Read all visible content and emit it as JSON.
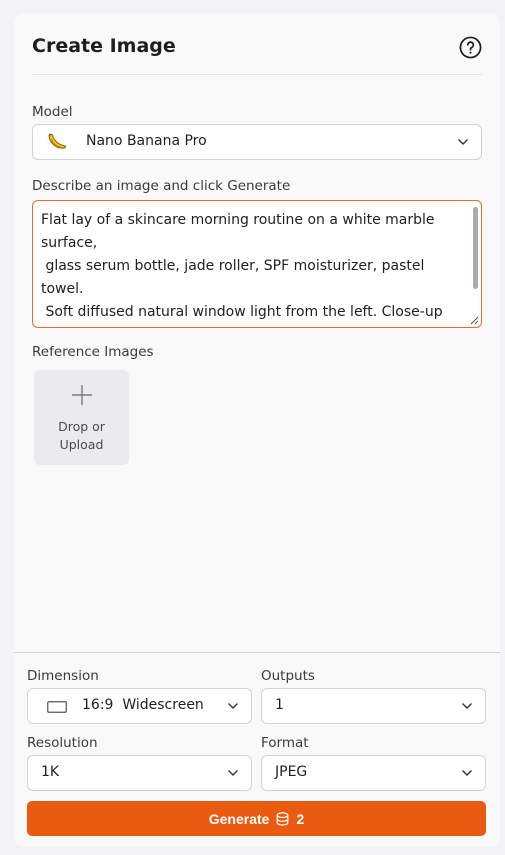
{
  "header": {
    "title": "Create Image",
    "help_icon": "question-circle-icon"
  },
  "model": {
    "label": "Model",
    "icon": "banana-icon",
    "selected": "Nano Banana Pro"
  },
  "prompt": {
    "label": "Describe an image and click Generate",
    "value": "Flat lay of a skincare morning routine on a white marble surface,\n glass serum bottle, jade roller, SPF moisturizer, pastel towel.\n Soft diffused natural window light from the left. Close-up overhead shot."
  },
  "reference": {
    "label": "Reference Images",
    "upload_text": "Drop or\nUpload",
    "icon": "plus-icon"
  },
  "settings": {
    "dimension": {
      "label": "Dimension",
      "value": "16:9  Widescreen",
      "icon": "aspect-ratio-icon"
    },
    "outputs": {
      "label": "Outputs",
      "value": "1"
    },
    "resolution": {
      "label": "Resolution",
      "value": "1K"
    },
    "format": {
      "label": "Format",
      "value": "JPEG"
    }
  },
  "generate": {
    "label": "Generate",
    "credits": "2",
    "icon": "credits-coin-icon"
  },
  "colors": {
    "accent": "#ea5a0f",
    "focus_border": "#ec6a2c",
    "panel_bg": "#f9f9fa"
  }
}
